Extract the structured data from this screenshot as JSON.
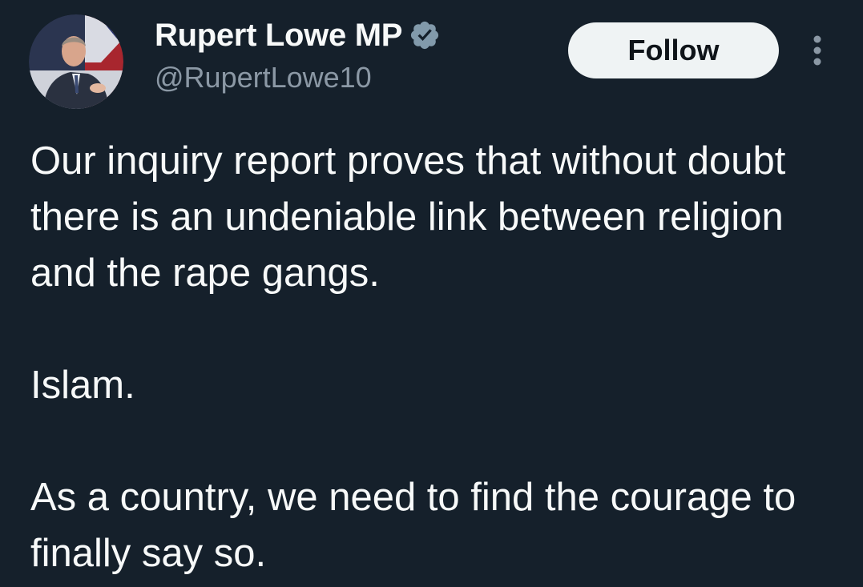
{
  "author": {
    "display_name": "Rupert Lowe MP",
    "handle": "@RupertLowe10",
    "verified": true,
    "avatar_icon": "profile-photo-avatar"
  },
  "actions": {
    "follow_label": "Follow",
    "more_icon": "more-options-icon"
  },
  "tweet": {
    "paragraphs": [
      "Our inquiry report proves that without doubt there is an undeniable link between religion and the rape gangs.",
      "Islam.",
      "As a country, we need to find the courage to finally say so."
    ]
  },
  "colors": {
    "background": "#15202b",
    "text_primary": "#f7f9f9",
    "text_secondary": "#8b98a5",
    "verified_badge": "#829aab",
    "follow_button_bg": "#eff3f4",
    "follow_button_text": "#0f1419"
  }
}
